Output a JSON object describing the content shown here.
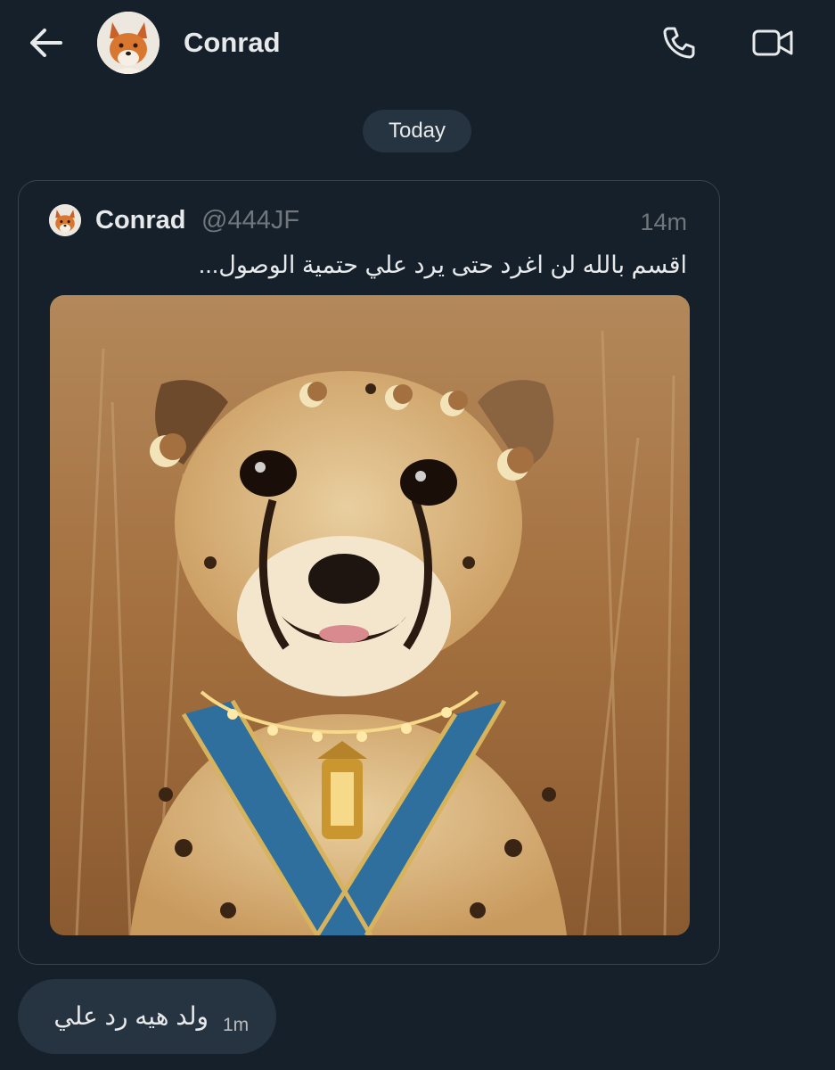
{
  "header": {
    "back_icon": "arrow-left-icon",
    "contact_name": "Conrad",
    "call_icon": "phone-icon",
    "video_icon": "video-camera-icon"
  },
  "date_separator": "Today",
  "shared_tweet": {
    "author_name": "Conrad",
    "author_handle": "@444JF",
    "time": "14m",
    "text": "اقسم بالله لن اغرد حتى يرد علي حتمية الوصول...",
    "media_description": "photo"
  },
  "reply": {
    "text": "ولد هيه رد علي",
    "time": "1m"
  },
  "colors": {
    "background": "#15202b",
    "bubble": "#263340",
    "border": "#38444d",
    "text_primary": "#e7e9ea",
    "text_secondary": "#71767b"
  }
}
